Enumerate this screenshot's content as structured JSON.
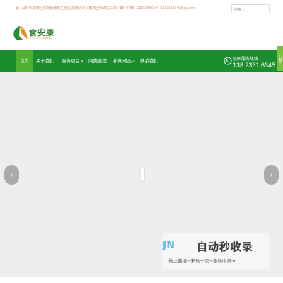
{
  "topbar": {
    "address": "深圳市龙岗区龙岗街道新生社区龙岗区沙头角商业街四区二D3",
    "phone": "0755 - 2316 6001",
    "email": "1662135649@qq.com",
    "search_placeholder": "搜索..."
  },
  "brand": {
    "name": "食安康",
    "subtitle": "SHI AN KANG",
    "primary_color": "#1c8d2e",
    "accent_color": "#f08a24"
  },
  "nav": {
    "items": [
      {
        "label": "首页",
        "active": true
      },
      {
        "label": "关于我们"
      },
      {
        "label": "服务项目",
        "caret": "▾"
      },
      {
        "label": "同类业绩"
      },
      {
        "label": "新闻动态",
        "caret": "▾"
      },
      {
        "label": "联系我们"
      }
    ],
    "hotline_label": "全国服务热线",
    "hotline_number": "138 2331 6345"
  },
  "share": {
    "label": "分享"
  },
  "slider": {
    "prev_icon": "chevron-left-icon",
    "next_icon": "chevron-right-icon",
    "prev_glyph": "‹",
    "next_glyph": "›"
  },
  "watermark": {
    "logo_text": "JN",
    "title": "自动秒收录",
    "subtitle": "做上链接→来访一次→自动收录→"
  }
}
